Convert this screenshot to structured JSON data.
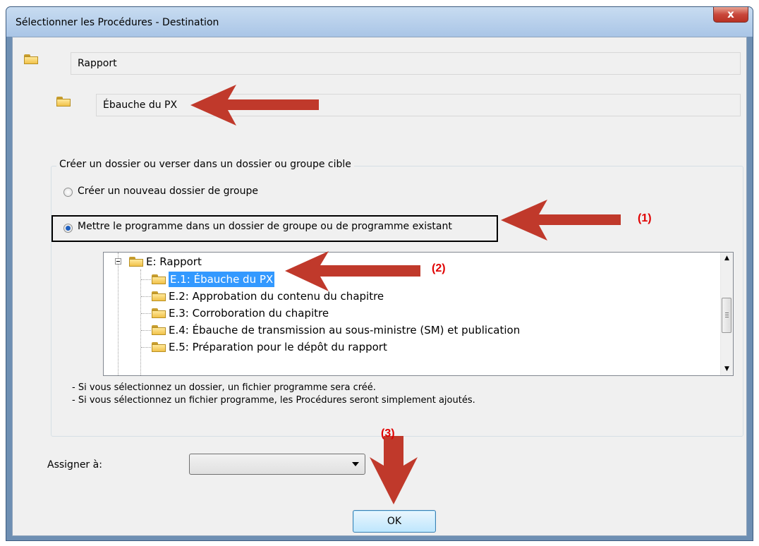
{
  "window": {
    "title": "Sélectionner les Procédures - Destination",
    "close_label": "x"
  },
  "fields": {
    "rapport": "Rapport",
    "ebauche": "Ébauche du PX"
  },
  "group": {
    "label": "Créer un dossier ou verser dans un dossier ou groupe cible",
    "radio_new": "Créer un nouveau dossier de groupe",
    "radio_existing": "Mettre le programme dans un dossier de groupe ou de programme existant",
    "radio_existing_checked": true
  },
  "tree": {
    "root": "E: Rapport",
    "items": [
      {
        "label": "E.1: Ébauche du PX",
        "selected": true
      },
      {
        "label": "E.2: Approbation du contenu du chapitre",
        "selected": false
      },
      {
        "label": "E.3: Corroboration du chapitre",
        "selected": false
      },
      {
        "label": "E.4: Ébauche de transmission au sous-ministre (SM) et publication",
        "selected": false
      },
      {
        "label": "E.5: Préparation pour le dépôt du rapport",
        "selected": false
      }
    ]
  },
  "notes": [
    "- Si vous sélectionnez un dossier, un fichier programme sera créé.",
    "- Si vous sélectionnez un fichier programme, les Procédures seront simplement ajoutés."
  ],
  "assign": {
    "label": "Assigner à:",
    "value": ""
  },
  "buttons": {
    "ok": "OK"
  },
  "annotations": {
    "a1": "(1)",
    "a2": "(2)",
    "a3": "(3)",
    "color": "#e00000",
    "arrow_color": "#c0392b"
  }
}
